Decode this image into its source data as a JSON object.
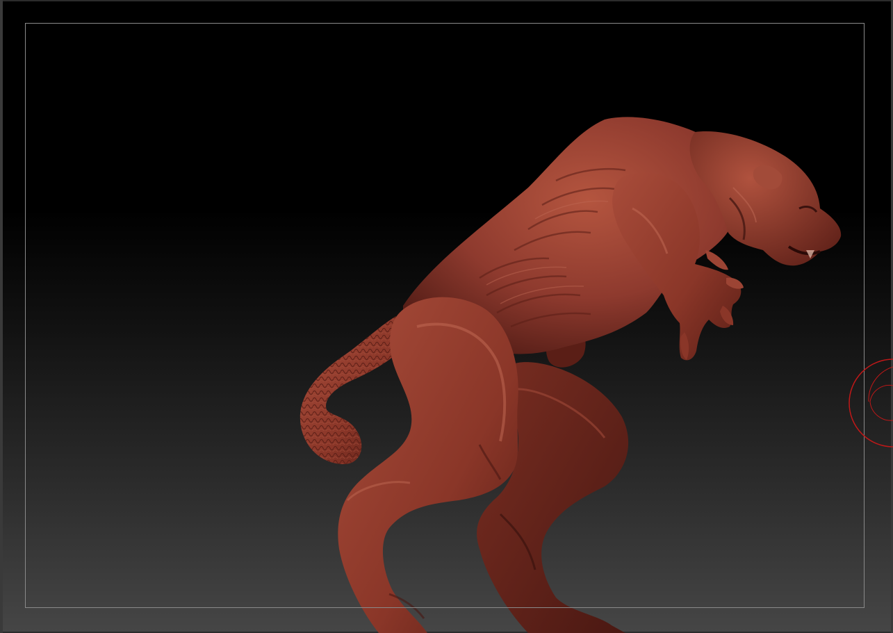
{
  "viewport": {
    "background_top": "#000000",
    "background_bottom": "#464646",
    "frame_color": "#8a8a8a"
  },
  "model": {
    "kind": "sculpted creature",
    "material_color": "#8e3a2e",
    "highlight_color": "#b85a48",
    "shadow_color": "#4a1812"
  },
  "gizmo": {
    "icon": "rotation-ring-icon",
    "color": "#c01818"
  }
}
